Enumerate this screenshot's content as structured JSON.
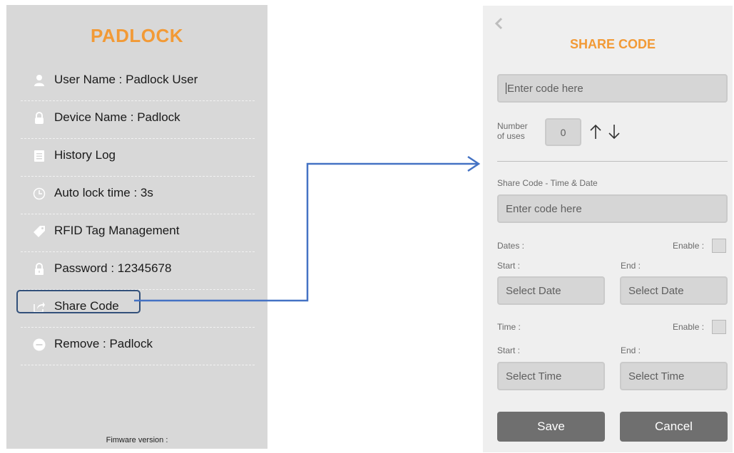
{
  "left": {
    "title": "PADLOCK",
    "menu": [
      {
        "icon": "user-icon",
        "label": "User Name : Padlock User"
      },
      {
        "icon": "device-lock-icon",
        "label": "Device Name : Padlock"
      },
      {
        "icon": "document-list-icon",
        "label": "History Log"
      },
      {
        "icon": "clock-icon",
        "label": "Auto lock time : 3s"
      },
      {
        "icon": "tag-icon",
        "label": "RFID Tag Management"
      },
      {
        "icon": "lock-icon",
        "label": "Password : 12345678"
      },
      {
        "icon": "share-icon",
        "label": "Share Code"
      },
      {
        "icon": "minus-circle-icon",
        "label": "Remove : Padlock"
      }
    ],
    "firmware_label": "Fimware version :"
  },
  "right": {
    "title": "SHARE CODE",
    "code_placeholder": "Enter code here",
    "uses_label_line1": "Number",
    "uses_label_line2": "of uses",
    "uses_value": "0",
    "time_date_label": "Share Code - Time & Date",
    "time_date_placeholder": "Enter code here",
    "dates_label": "Dates :",
    "dates_enable_label": "Enable :",
    "dates_start_label": "Start :",
    "dates_end_label": "End :",
    "select_date_start": "Select Date",
    "select_date_end": "Select Date",
    "time_label": "Time :",
    "time_enable_label": "Enable :",
    "time_start_label": "Start :",
    "time_end_label": "End :",
    "select_time_start": "Select Time",
    "select_time_end": "Select Time",
    "save_label": "Save",
    "cancel_label": "Cancel"
  },
  "colors": {
    "accent": "#f29a36",
    "connector": "#4472c4",
    "highlight": "#32507a",
    "button": "#6f6f6f"
  }
}
